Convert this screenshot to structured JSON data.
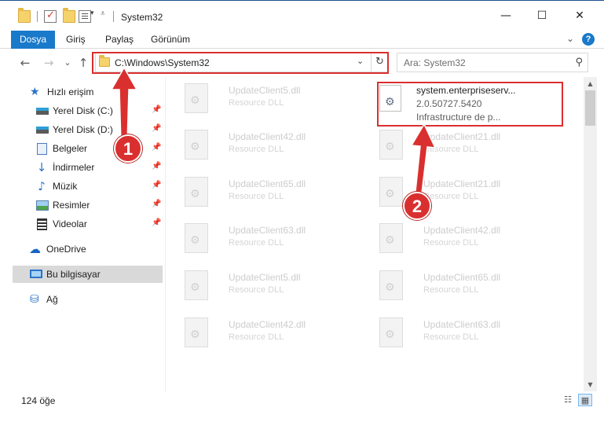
{
  "window": {
    "title": "System32",
    "minimize_glyph": "—",
    "maximize_glyph": "☐",
    "close_glyph": "✕"
  },
  "ribbon": {
    "tabs": [
      "Dosya",
      "Giriş",
      "Paylaş",
      "Görünüm"
    ],
    "expand_glyph": "⌄",
    "help_glyph": "?"
  },
  "navigation": {
    "back_glyph": "←",
    "forward_glyph": "→",
    "recent_glyph": "⌄",
    "up_glyph": "↑",
    "address": "C:\\Windows\\System32",
    "address_dropdown_glyph": "⌄",
    "refresh_glyph": "↻",
    "search_placeholder": "Ara: System32",
    "search_glyph": "⚲"
  },
  "sidebar": {
    "items": [
      {
        "label": "Hızlı erişim",
        "icon": "quick-access-star-icon",
        "glyph": "★"
      },
      {
        "label": "Yerel Disk (C:)",
        "icon": "drive-icon",
        "pinned": true
      },
      {
        "label": "Yerel Disk (D:)",
        "icon": "drive-icon",
        "pinned": true
      },
      {
        "label": "Belgeler",
        "icon": "documents-icon",
        "pinned": true
      },
      {
        "label": "İndirmeler",
        "icon": "downloads-icon",
        "glyph": "↓",
        "pinned": true
      },
      {
        "label": "Müzik",
        "icon": "music-icon",
        "glyph": "♪",
        "pinned": true
      },
      {
        "label": "Resimler",
        "icon": "pictures-icon",
        "pinned": true
      },
      {
        "label": "Videolar",
        "icon": "videos-icon",
        "pinned": true
      },
      {
        "label": "OneDrive",
        "icon": "onedrive-cloud-icon",
        "glyph": "☁"
      },
      {
        "label": "Bu bilgisayar",
        "icon": "this-pc-icon"
      },
      {
        "label": "Ağ",
        "icon": "network-icon",
        "glyph": "⛁"
      }
    ],
    "pin_glyph": "📌"
  },
  "files": {
    "left_column": [
      {
        "name": "UpdateClient5.dll",
        "type": "Resource DLL"
      },
      {
        "name": "UpdateClient42.dll",
        "type": "Resource DLL"
      },
      {
        "name": "UpdateClient65.dll",
        "type": "Resource DLL"
      },
      {
        "name": "UpdateClient63.dll",
        "type": "Resource DLL"
      },
      {
        "name": "UpdateClient5.dll",
        "type": "Resource DLL"
      },
      {
        "name": "UpdateClient42.dll",
        "type": "Resource DLL"
      }
    ],
    "right_column": [
      {
        "name": "system.enterpriseserv...",
        "version": "2.0.50727.5420",
        "type": "Infrastructure de p..."
      },
      {
        "name": "UpdateClient21.dll",
        "type": "Resource DLL"
      },
      {
        "name": "UpdateClient21.dll",
        "type": "Resource DLL"
      },
      {
        "name": "UpdateClient42.dll",
        "type": "Resource DLL"
      },
      {
        "name": "UpdateClient65.dll",
        "type": "Resource DLL"
      },
      {
        "name": "UpdateClient63.dll",
        "type": "Resource DLL"
      }
    ]
  },
  "status": {
    "item_count": "124 öğe",
    "details_view_glyph": "☷",
    "tiles_view_glyph": "▦"
  },
  "annotations": {
    "badge1": "1",
    "badge2": "2",
    "color": "#d9302f"
  },
  "scrollbar": {
    "up_glyph": "▲",
    "down_glyph": "▼"
  }
}
